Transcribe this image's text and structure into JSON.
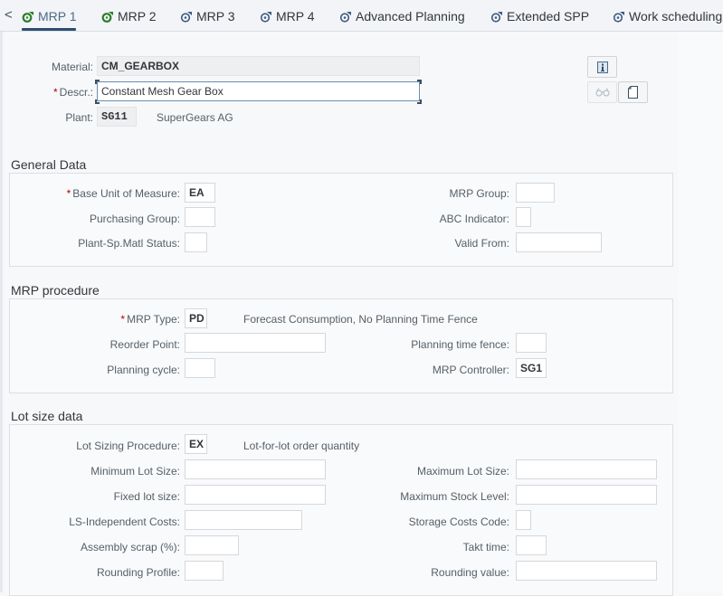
{
  "tabs": [
    {
      "label": "MRP 1",
      "icon": "mrp-green-icon",
      "active": true
    },
    {
      "label": "MRP 2",
      "icon": "mrp-green-icon",
      "active": false
    },
    {
      "label": "MRP 3",
      "icon": "mrp-blue-icon",
      "active": false
    },
    {
      "label": "MRP 4",
      "icon": "mrp-blue-icon",
      "active": false
    },
    {
      "label": "Advanced Planning",
      "icon": "mrp-blue-icon",
      "active": false
    },
    {
      "label": "Extended SPP",
      "icon": "mrp-blue-icon",
      "active": false
    },
    {
      "label": "Work scheduling",
      "icon": "mrp-blue-icon",
      "active": false
    }
  ],
  "back_glyph": "<",
  "header": {
    "material_label": "Material:",
    "material_value": "CM_GEARBOX",
    "descr_label": "Descr.:",
    "descr_value": "Constant Mesh Gear Box",
    "plant_label": "Plant:",
    "plant_value": "SG11",
    "plant_name": "SuperGears AG",
    "required_marker": "*"
  },
  "header_buttons": [
    {
      "icon": "info-icon",
      "enabled": true
    },
    {
      "icon": "glasses-icon",
      "enabled": false
    },
    {
      "icon": "document-icon",
      "enabled": true
    }
  ],
  "general_data": {
    "title": "General Data",
    "left": [
      {
        "label": "Base Unit of Measure:",
        "value": "EA",
        "required": true
      },
      {
        "label": "Purchasing Group:",
        "value": ""
      },
      {
        "label": "Plant-Sp.Matl Status:",
        "value": ""
      }
    ],
    "right": [
      {
        "label": "MRP Group:",
        "value": ""
      },
      {
        "label": "ABC Indicator:",
        "value": ""
      },
      {
        "label": "Valid From:",
        "value": ""
      }
    ]
  },
  "mrp_procedure": {
    "title": "MRP procedure",
    "mrp_type": {
      "label": "MRP Type:",
      "value": "PD",
      "required": true,
      "description": "Forecast Consumption, No Planning Time Fence"
    },
    "reorder_point": {
      "label": "Reorder Point:",
      "value": ""
    },
    "planning_cycle": {
      "label": "Planning cycle:",
      "value": ""
    },
    "planning_time_fence": {
      "label": "Planning time fence:",
      "value": ""
    },
    "mrp_controller": {
      "label": "MRP Controller:",
      "value": "SG1"
    }
  },
  "lot_size": {
    "title": "Lot size data",
    "procedure": {
      "label": "Lot Sizing Procedure:",
      "value": "EX",
      "description": "Lot-for-lot order quantity"
    },
    "left": [
      {
        "label": "Minimum Lot Size:",
        "value": ""
      },
      {
        "label": "Fixed lot size:",
        "value": ""
      },
      {
        "label": "LS-Independent Costs:",
        "value": ""
      },
      {
        "label": "Assembly scrap (%):",
        "value": ""
      },
      {
        "label": "Rounding Profile:",
        "value": ""
      }
    ],
    "right": [
      {
        "label": "Maximum Lot Size:",
        "value": ""
      },
      {
        "label": "Maximum Stock Level:",
        "value": ""
      },
      {
        "label": "Storage Costs Code:",
        "value": ""
      },
      {
        "label": "Takt time:",
        "value": ""
      },
      {
        "label": "Rounding value:",
        "value": ""
      }
    ]
  },
  "colors": {
    "active_tab": "#4c6a85",
    "tab_underline": "#2c4d6e",
    "icon_green": "#2b7d2b",
    "icon_blue": "#3d5a80",
    "required": "#bb0000"
  }
}
